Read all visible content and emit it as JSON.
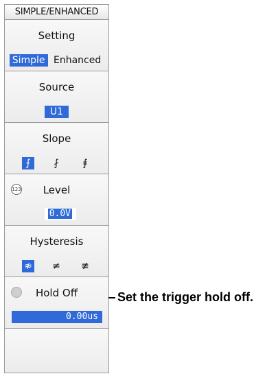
{
  "panel": {
    "title": "SIMPLE/ENHANCED",
    "setting": {
      "label": "Setting",
      "options": [
        "Simple",
        "Enhanced"
      ],
      "selected": "Simple"
    },
    "source": {
      "label": "Source",
      "value": "U1"
    },
    "slope": {
      "label": "Slope",
      "options": [
        "rising-edge-icon",
        "falling-edge-icon",
        "both-edges-icon"
      ],
      "selected": "rising-edge-icon"
    },
    "level": {
      "label": "Level",
      "knob_text": "123",
      "value": "0.0V"
    },
    "hysteresis": {
      "label": "Hysteresis",
      "options": [
        "hysteresis-low-icon",
        "hysteresis-mid-icon",
        "hysteresis-high-icon"
      ],
      "selected": "hysteresis-low-icon"
    },
    "holdoff": {
      "label": "Hold Off",
      "value": "0.00us"
    }
  },
  "callout": {
    "text": "Set the trigger hold off."
  },
  "colors": {
    "selected_bg": "#2f6ad8",
    "panel_bg": "#f2f2f2"
  }
}
